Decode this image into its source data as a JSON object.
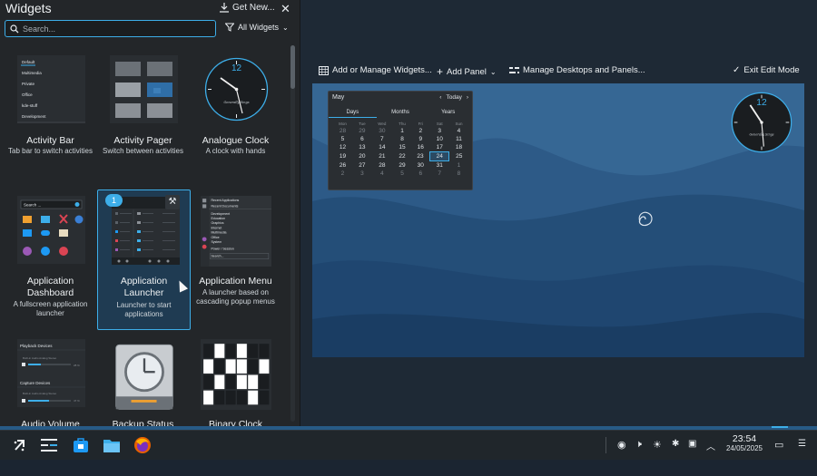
{
  "sidebar": {
    "title": "Widgets",
    "get_new_label": "Get New...",
    "search_placeholder": "Search...",
    "filter_label": "All Widgets"
  },
  "widgets": [
    {
      "name": "Activity Bar",
      "desc": "Tab bar to switch activities",
      "selected": false
    },
    {
      "name": "Activity Pager",
      "desc": "Switch between activities",
      "selected": false
    },
    {
      "name": "Analogue Clock",
      "desc": "A clock with hands",
      "selected": false
    },
    {
      "name": "Application Dashboard",
      "desc": "A fullscreen application launcher",
      "selected": false
    },
    {
      "name": "Application Launcher",
      "desc": "Launcher to start applications",
      "selected": true,
      "badge": "1"
    },
    {
      "name": "Application Menu",
      "desc": "A launcher based on cascading popup menus",
      "selected": false
    },
    {
      "name": "Audio Volume",
      "desc": "",
      "selected": false
    },
    {
      "name": "Backup Status",
      "desc": "",
      "selected": false
    },
    {
      "name": "Binary Clock",
      "desc": "",
      "selected": false
    }
  ],
  "activity_bar_thumb": [
    "Default",
    "Multimedia",
    "Private",
    "Office",
    "kde-stuff",
    "Development"
  ],
  "app_menu_thumb": [
    "Recent Applications",
    "Recent Documents",
    "Development",
    "Education",
    "Graphics",
    "Internet",
    "Multimedia",
    "Office",
    "System",
    "Power / Session",
    "Search..."
  ],
  "dashboard_thumb": {
    "search": "Search ..."
  },
  "audio_thumb": {
    "playback": "Playback Devices",
    "playback_dev": "Built-in Audio Analog Stereo",
    "playback_pct": "28 %",
    "capture": "Capture Devices",
    "capture_dev": "Built-in Audio Analog Stereo",
    "capture_pct": "47 %"
  },
  "clock_thumb": {
    "numeral": "12",
    "brand": "Generally Sings"
  },
  "toolbar": {
    "add_widgets": "Add or Manage Widgets...",
    "add_panel": "Add Panel",
    "manage": "Manage Desktops and Panels...",
    "exit": "Exit Edit Mode"
  },
  "calendar": {
    "month": "May",
    "today": "Today",
    "tabs": [
      "Days",
      "Months",
      "Years"
    ],
    "weekdays": [
      "Mon",
      "Tue",
      "Wed",
      "Thu",
      "Fri",
      "Sat",
      "Sun"
    ],
    "weeks": [
      [
        "28",
        "29",
        "30",
        "1",
        "2",
        "3",
        "4"
      ],
      [
        "5",
        "6",
        "7",
        "8",
        "9",
        "10",
        "11"
      ],
      [
        "12",
        "13",
        "14",
        "15",
        "16",
        "17",
        "18"
      ],
      [
        "19",
        "20",
        "21",
        "22",
        "23",
        "24",
        "25"
      ],
      [
        "26",
        "27",
        "28",
        "29",
        "30",
        "31",
        "1"
      ],
      [
        "2",
        "3",
        "4",
        "5",
        "6",
        "7",
        "8"
      ]
    ]
  },
  "clock": {
    "time": "23:54",
    "date": "24/05/2025"
  },
  "colors": {
    "accent": "#3daee9",
    "panel": "#232629",
    "wallpaper": "#2b5580"
  }
}
